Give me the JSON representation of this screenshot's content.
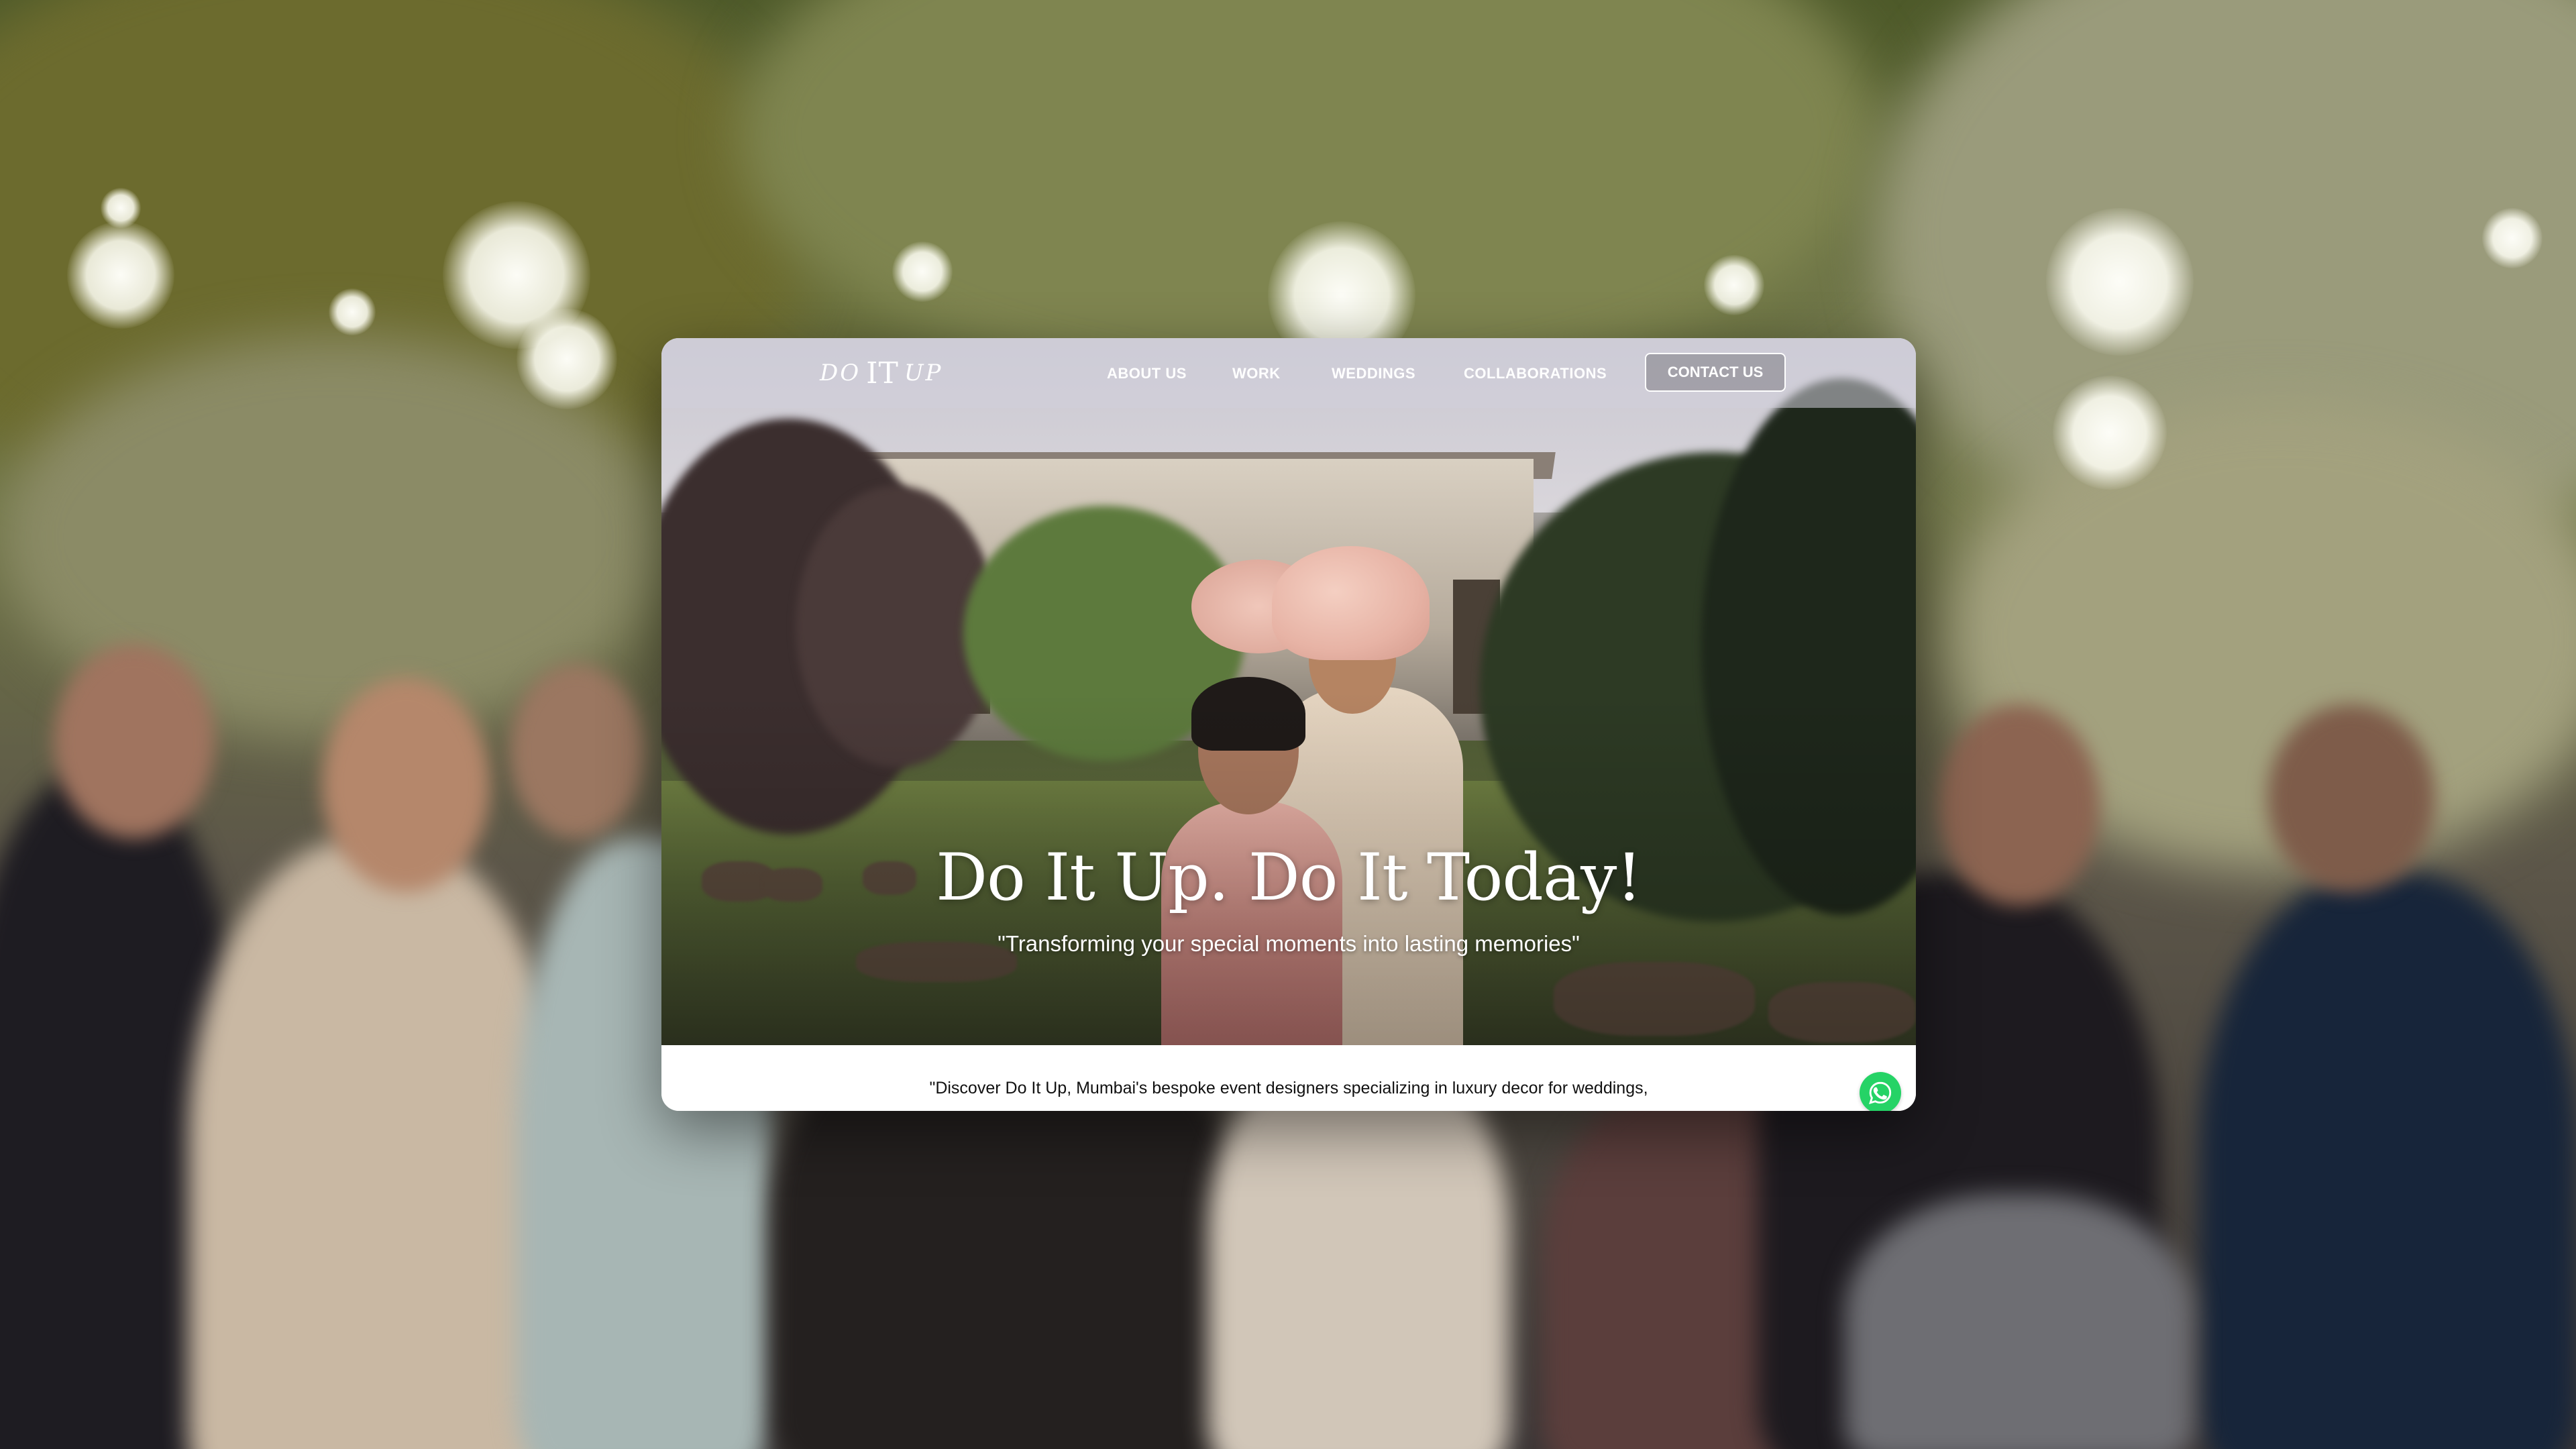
{
  "nav": {
    "logo": {
      "part1": "DO",
      "part2": "IT",
      "part3": "UP"
    },
    "links": [
      "ABOUT US",
      "WORK",
      "WEDDINGS",
      "COLLABORATIONS"
    ],
    "contact_label": "CONTACT US"
  },
  "hero": {
    "title": "Do It Up. Do It Today!",
    "subtitle": "\"Transforming your special moments into lasting memories\""
  },
  "intro": {
    "text": "\"Discover Do It Up, Mumbai's bespoke event designers specializing in luxury decor for weddings,"
  },
  "icons": {
    "whatsapp": "whatsapp-icon"
  },
  "colors": {
    "whatsapp_green": "#25d366",
    "nav_text": "#ffffff",
    "body_text": "#111111"
  }
}
